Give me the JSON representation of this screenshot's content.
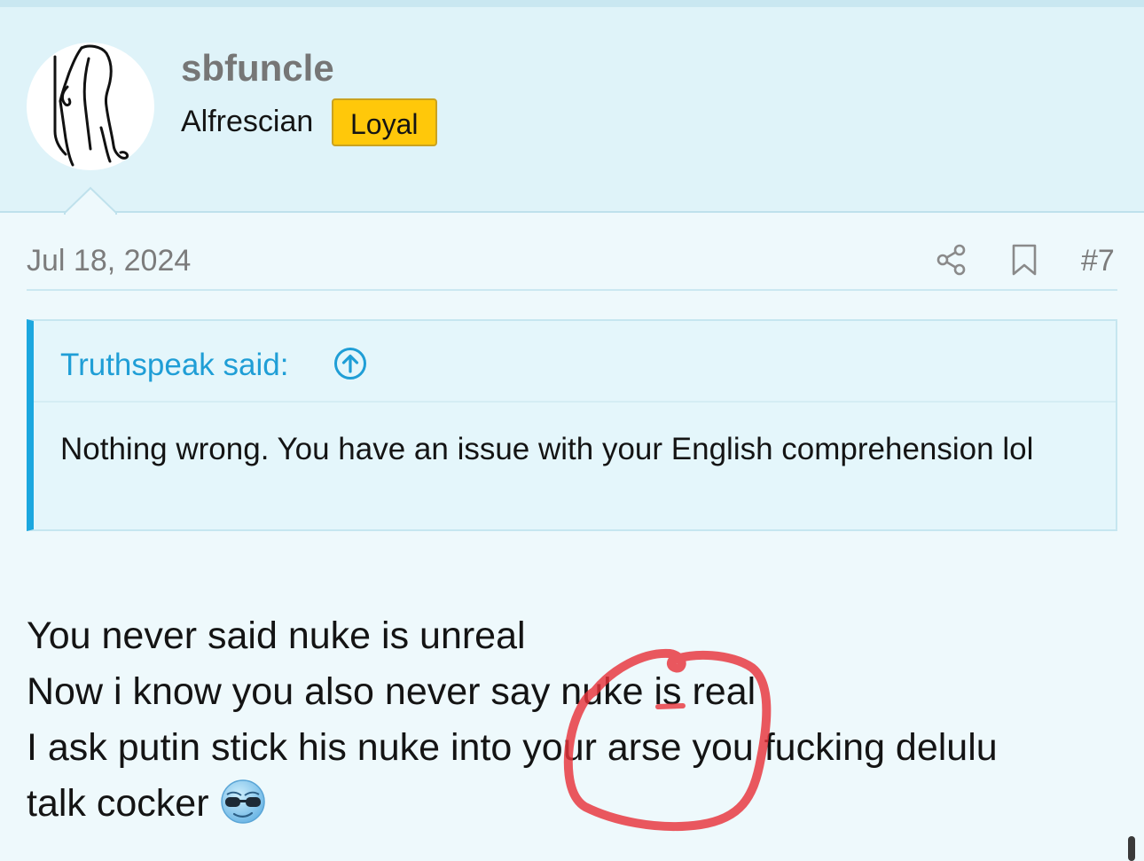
{
  "user": {
    "username": "sbfuncle",
    "title": "Alfrescian",
    "badge": "Loyal"
  },
  "post": {
    "date": "Jul 18, 2024",
    "number": "#7",
    "actions": [
      "share-icon",
      "bookmark-icon"
    ],
    "quote": {
      "author": "Truthspeak said:",
      "text": "Nothing wrong. You have an issue with your English comprehension lol"
    },
    "body_lines": [
      "You never said nuke is unreal",
      "Now i know you also never say nuke is real",
      "I ask putin stick his nuke into your arse you fucking delulu",
      "talk cocker"
    ],
    "emoji": "cool-sunglasses-emoji"
  },
  "colors": {
    "header_bg": "#dff3f9",
    "page_bg": "#eef9fc",
    "accent": "#1ba7df",
    "badge_bg": "#ffc80a",
    "annotation": "#e8333a"
  }
}
